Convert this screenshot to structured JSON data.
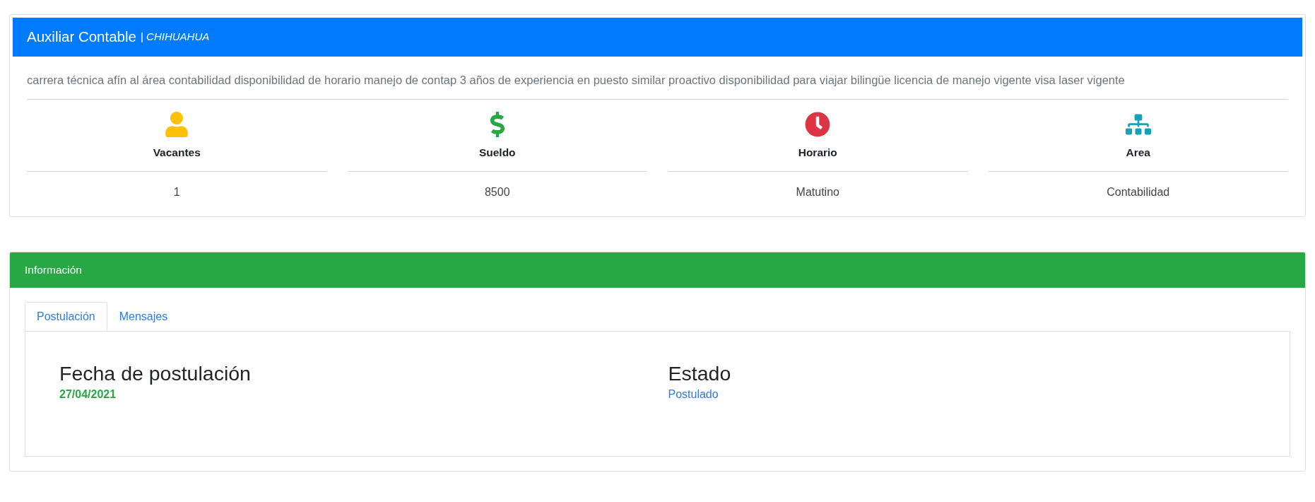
{
  "job": {
    "title": "Auxiliar Contable",
    "subtitle": "| *CHIHUAHUA*",
    "description": "carrera técnica afín al área contabilidad disponibilidad de horario manejo de contap 3 años de experiencia en puesto similar proactivo disponibilidad para viajar bilingüe licencia de manejo vigente visa laser vigente",
    "stats": [
      {
        "kind": "person",
        "color": "#ffc107",
        "label": "Vacantes",
        "value": "1"
      },
      {
        "kind": "money",
        "color": "#28a745",
        "label": "Sueldo",
        "value": "8500"
      },
      {
        "kind": "clock",
        "color": "#dc3545",
        "label": "Horario",
        "value": "Matutino"
      },
      {
        "kind": "org",
        "color": "#17a2b8",
        "label": "Area",
        "value": "Contabilidad"
      }
    ]
  },
  "info": {
    "title": "Información",
    "tabs": [
      {
        "label": "Postulación",
        "selected": true
      },
      {
        "label": "Mensajes",
        "selected": false
      }
    ],
    "fields": [
      {
        "kind": "date",
        "label": "Fecha de postulación",
        "value": "27/04/2021"
      },
      {
        "kind": "status",
        "label": "Estado",
        "value": "Postulado"
      }
    ]
  }
}
